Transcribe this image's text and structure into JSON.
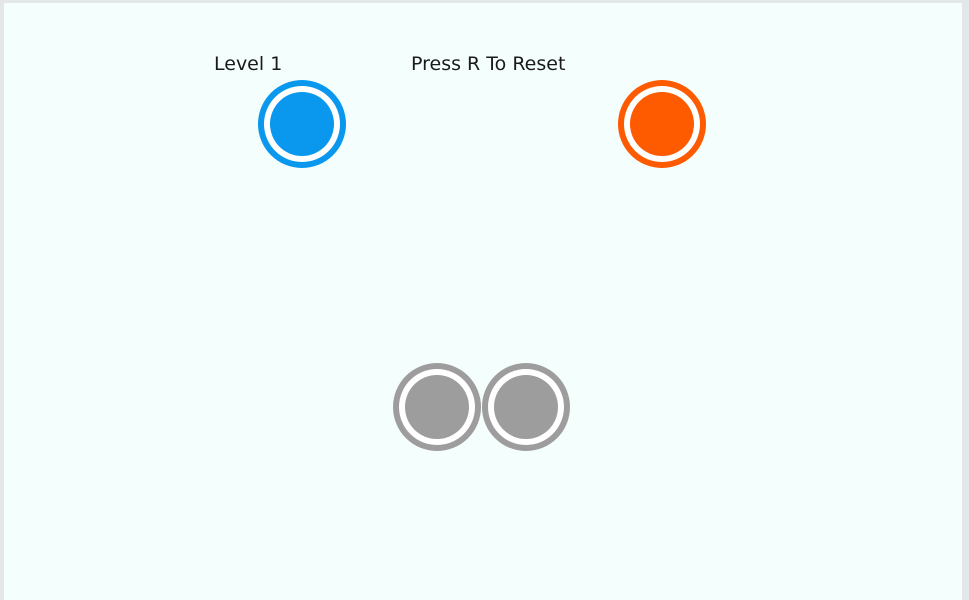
{
  "hud": {
    "level": "Level 1",
    "reset_hint": "Press R To Reset"
  },
  "colors": {
    "background": "#f4fffd",
    "blue": "#0a98ee",
    "orange": "#fe5a00",
    "grey": "#9d9d9d",
    "ring": "#ffffff"
  },
  "orbs": [
    {
      "name": "blue-player-orb",
      "color": "blue"
    },
    {
      "name": "orange-player-orb",
      "color": "orange"
    },
    {
      "name": "grey-orb-left",
      "color": "grey"
    },
    {
      "name": "grey-orb-right",
      "color": "grey"
    }
  ]
}
